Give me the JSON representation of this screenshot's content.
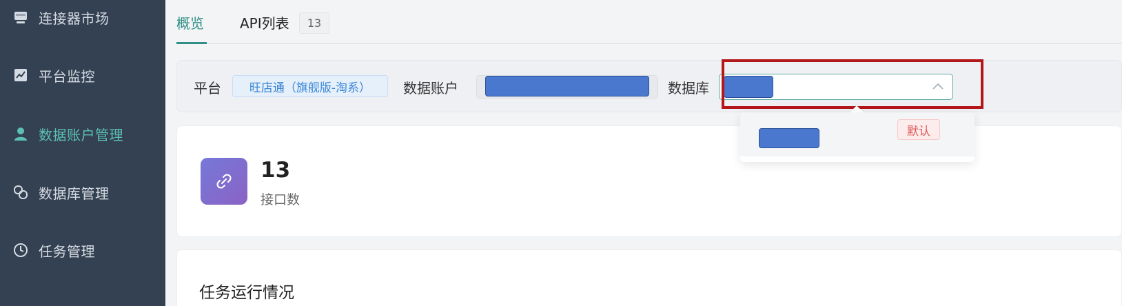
{
  "sidebar": {
    "items": [
      {
        "label": "连接器市场",
        "icon": "store-icon"
      },
      {
        "label": "平台监控",
        "icon": "chart-icon"
      },
      {
        "label": "数据账户管理",
        "icon": "user-icon",
        "active": true
      },
      {
        "label": "数据库管理",
        "icon": "link-loop-icon"
      },
      {
        "label": "任务管理",
        "icon": "clock-icon"
      }
    ]
  },
  "tabs": [
    {
      "label": "概览",
      "active": true
    },
    {
      "label": "API列表",
      "badge": "13"
    }
  ],
  "filters": {
    "platform_label": "平台",
    "platform_value": "旺店通（旗舰版-淘系）",
    "account_label": "数据账户",
    "database_label": "数据库"
  },
  "dropdown": {
    "option_tag": "默认"
  },
  "stats": {
    "api_count": "13",
    "api_count_label": "接口数"
  },
  "section": {
    "title": "任务运行情况"
  },
  "colors": {
    "sidebar_bg": "#344152",
    "accent": "#2f8f86",
    "highlight": "#b3171c",
    "redaction": "#4a78cf"
  }
}
